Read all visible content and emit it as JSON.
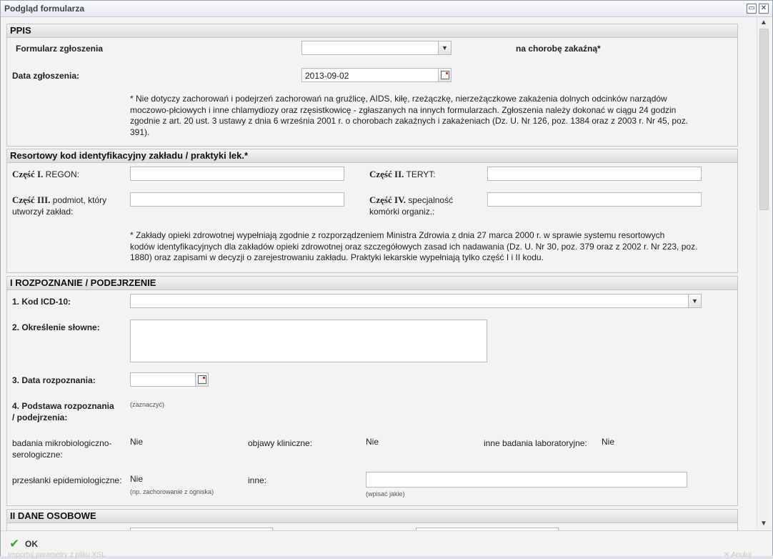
{
  "window": {
    "title": "Podgląd formularza",
    "restore_symbol": "▭",
    "close_symbol": "✕"
  },
  "ppis": {
    "header": "PPIS",
    "form_label": "Formularz zgłoszenia",
    "form_value": "",
    "disease_label": "na chorobę zakaźną*",
    "date_label": "Data zgłoszenia:",
    "date_value": "2013-09-02",
    "note_lines": [
      "* Nie dotyczy zachorowań i podejrzeń zachorowań na gruźlicę, AIDS, kiłę, rzeżączkę, nierzeżączkowe zakażenia dolnych odcinków narządów",
      "moczowo-płciowych i inne chlamydiozy oraz rzęsistkowicę - zgłaszanych na innych formularzach. Zgłoszenia należy dokonać w ciągu 24 godzin",
      "zgodnie z art. 20 ust. 3 ustawy z dnia 6 września 2001 r. o chorobach zakaźnych i zakażeniach (Dz. U. Nr 126, poz. 1384 oraz z 2003 r. Nr 45, poz.",
      "391)."
    ]
  },
  "resort": {
    "header": "Resortowy kod identyfikacyjny zakładu / praktyki lek.*",
    "part1_prefix": "Część I.",
    "part1_label": "REGON:",
    "part2_prefix": "Część II.",
    "part2_label": "TERYT:",
    "part3_prefix": "Część III.",
    "part3_label_a": "podmiot, który",
    "part3_label_b": "utworzył zakład:",
    "part4_prefix": "Część IV.",
    "part4_label_a": "specjalność",
    "part4_label_b": "komórki organiz.:",
    "note_lines": [
      "* Zakłady opieki zdrowotnej wypełniają zgodnie z rozporządzeniem Ministra Zdrowia z dnia 27 marca 2000 r. w sprawie systemu resortowych",
      "kodów identyfikacyjnych dla zakładów opieki zdrowotnej oraz szczegółowych zasad ich nadawania (Dz. U. Nr 30, poz. 379 oraz z 2002 r. Nr 223, poz.",
      "1880) oraz zapisami w decyzji o zarejestrowaniu zakładu. Praktyki lekarskie wypełniają tylko część I i II kodu."
    ]
  },
  "diagnosis": {
    "header": "I ROZPOZNANIE / PODEJRZENIE",
    "icd_label": "1. Kod ICD-10:",
    "verbal_label": "2. Określenie słowne:",
    "date_label": "3. Data rozpoznania:",
    "basis_label_a": "4. Podstawa rozpoznania",
    "basis_label_b": "/ podejrzenia:",
    "basis_hint": "(zaznaczyć)",
    "micro_label_a": "badania mikrobiologiczno-",
    "micro_label_b": "serologiczne:",
    "micro_value": "Nie",
    "symptoms_label": "objawy kliniczne:",
    "symptoms_value": "Nie",
    "lab_label": "inne badania laboratoryjne:",
    "lab_value": "Nie",
    "epi_label": "przesłanki epidemiologiczne:",
    "epi_value": "Nie",
    "epi_hint": "(np. zachorowanie z ogniska)",
    "other_label": "inne:",
    "other_hint": "(wpisać jakie)"
  },
  "personal": {
    "header": "II DANE OSOBOWE"
  },
  "footer": {
    "ok_label": "OK",
    "bg_left": "Importuj parametry z pliku XSL",
    "bg_right": "✕ Anuluj"
  }
}
